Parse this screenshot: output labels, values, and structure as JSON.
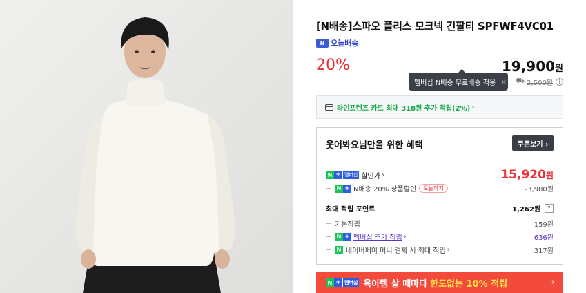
{
  "product": {
    "title": "[N배송]스파오 플리스 모크넥 긴팔티 SPFWF4VC01",
    "today_badge": "N",
    "today_label": "오늘배송",
    "discount": "20%",
    "price": "19,900",
    "price_unit": "원",
    "tooltip": "멤버십 N배송 무료배송 적용",
    "tooltip_close": "×",
    "shipping_old": "2,500원",
    "truck_icon": "⛟"
  },
  "card_offer": {
    "label": "라인프렌즈 카드 최대 318원 추가 적립(2%)",
    "chevron": "›"
  },
  "benefit": {
    "header": "웃어봐요님만을 위한 혜택",
    "coupon_button": "쿠폰보기 ›",
    "discounted_label": "할인가",
    "discounted_chevron": "›",
    "discounted_price": "15,920",
    "discounted_unit": "원",
    "n_discount_label": "N배송 20% 상품할인",
    "n_discount_pill": "오늘까지",
    "n_discount_amount": "-3,980원",
    "points_label": "최대 적립 포인트",
    "points_value": "1,262원",
    "points_help": "?",
    "base_label": "기본적립",
    "base_value": "159원",
    "member_label": "멤버십 추가 적립",
    "member_value": "636원",
    "pay_label": "네이버페이 머니 결제 시 최대 적립",
    "pay_value": "317원"
  },
  "badges": {
    "n": "N",
    "plus": "+",
    "membership": "멤버십"
  },
  "banner": {
    "text1": "육아템 살 때마다",
    "text2": "한도없는 10% 적립",
    "arrow": "›"
  },
  "colors": {
    "red": "#e8323a",
    "green": "#1cc35a",
    "blue": "#2f5de0",
    "banner": "#f24b3c"
  }
}
